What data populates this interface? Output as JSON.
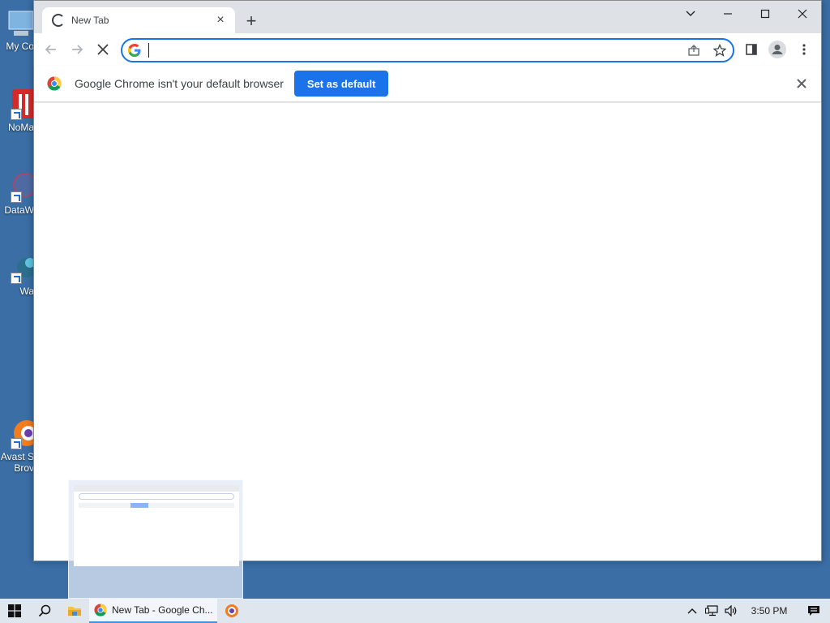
{
  "desktop": {
    "icons": [
      {
        "label": "My Co"
      },
      {
        "label": "NoMa"
      },
      {
        "label": "DataW"
      },
      {
        "label": "Wa"
      },
      {
        "label": "Avast S"
      },
      {
        "label": "Brov"
      }
    ]
  },
  "browser": {
    "tab": {
      "title": "New Tab",
      "close": "×"
    },
    "new_tab": "+",
    "omnibox": {
      "value": ""
    },
    "infobar": {
      "message": "Google Chrome isn't your default browser",
      "button": "Set as default"
    }
  },
  "taskbar": {
    "chrome_item": "New Tab - Google Ch...",
    "clock": "3:50 PM"
  },
  "colors": {
    "accent": "#1a73e8",
    "desktop": "#3a6ea5",
    "tabstrip": "#dee1e6"
  }
}
